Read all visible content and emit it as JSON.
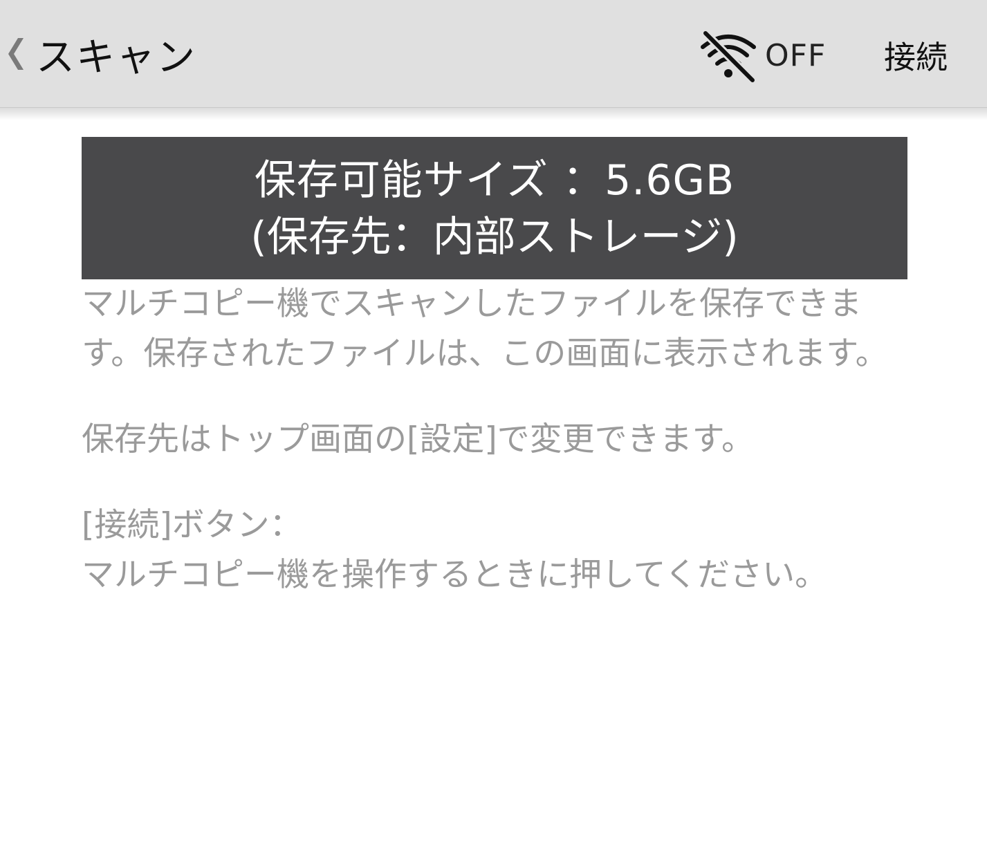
{
  "header": {
    "back_label": "スキャン",
    "wifi_status": "OFF",
    "connect_label": "接続"
  },
  "storage": {
    "line1": "保存可能サイズ ：5.6GB",
    "line2": "(保存先：内部ストレージ)"
  },
  "description": {
    "para1": "マルチコピー機でスキャンしたファイルを保存できます。保存されたファイルは、この画面に表示されます。",
    "para2": "保存先はトップ画面の[設定]で変更できます。",
    "para3_line1": "[接続]ボタン：",
    "para3_line2": "マルチコピー機を操作するときに押してください。"
  },
  "icons": {
    "back": "chevron-left-icon",
    "wifi": "wifi-off-icon"
  },
  "colors": {
    "header_bg": "#e0e0e0",
    "banner_bg": "#49494b",
    "body_text": "#9a9a9a"
  }
}
